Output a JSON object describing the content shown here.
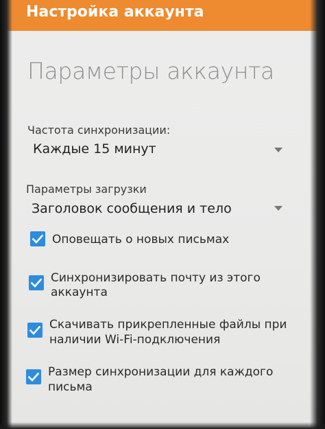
{
  "header": {
    "title": "Настройка аккаунта",
    "background": "#ee8a2f"
  },
  "page": {
    "title": "Параметры аккаунта"
  },
  "sync_frequency": {
    "label": "Частота синхронизации:",
    "value": "Каждые 15 минут",
    "icon": "triangle-down-icon"
  },
  "download_options": {
    "label": "Параметры загрузки",
    "value": "Заголовок сообщения и тело",
    "icon": "triangle-down-icon"
  },
  "checkboxes": [
    {
      "label_lines": [
        "Оповещать о новых письмах"
      ],
      "checked": true
    },
    {
      "label_lines": [
        "Синхронизировать почту из этого",
        "аккаунта"
      ],
      "checked": true
    },
    {
      "label_lines": [
        "Скачивать прикрепленные файлы при",
        "наличии Wi-Fi-подключения"
      ],
      "checked": true
    },
    {
      "label_lines": [
        "Размер синхронизации для каждого",
        "письма"
      ],
      "checked": true
    }
  ],
  "colors": {
    "accent": "#ee8a2f",
    "checkbox": "#2d8cde"
  }
}
